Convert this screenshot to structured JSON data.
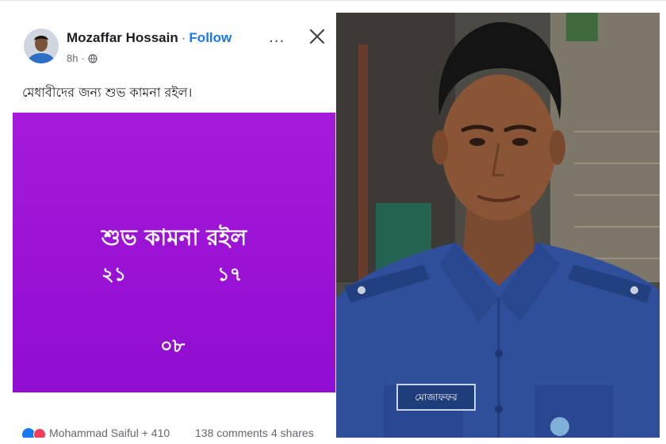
{
  "post": {
    "author_name": "Mozaffar Hossain",
    "separator": "·",
    "follow_label": "Follow",
    "time": "8h",
    "more_label": "···",
    "caption": "মেধাবীদের জন্য শুভ কামনা রইল।",
    "banner": {
      "heading": "শুভ কামনা রইল",
      "numbers": [
        "২১",
        "১৭",
        "০৮"
      ]
    },
    "footer": {
      "reactors": "Mohammad Saiful + 410",
      "comments": "138 comments",
      "shares": "4 shares"
    }
  },
  "photo": {
    "name_tag": "মোজাফফর"
  },
  "colors": {
    "banner": "#9a12d4",
    "follow": "#1877f2",
    "uniform": "#2f4f9a"
  }
}
